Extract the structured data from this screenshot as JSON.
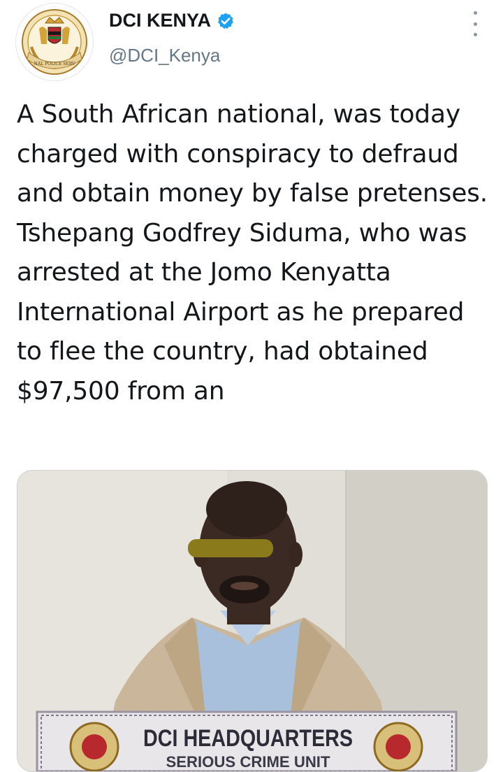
{
  "tweet": {
    "display_name": "DCI KENYA",
    "handle": "@DCI_Kenya",
    "text": "A South African national, was today charged with conspiracy to defraud and obtain money by false pretenses. Tshepang Godfrey Siduma, who was arrested at the Jomo Kenyatta International Airport as he prepared to flee the country, had obtained $97,500 from an"
  },
  "avatar": {
    "badge_text": "NAL POLICE SERV"
  },
  "media": {
    "placard_title": "DCI HEADQUARTERS",
    "placard_subtitle": "SERIOUS CRIME UNIT"
  },
  "colors": {
    "verified": "#1da1f2",
    "handle": "#657786",
    "text": "#14171a",
    "more": "#8899a6"
  },
  "icons": {
    "verified": "verified-badge-icon",
    "more": "more-vertical-icon"
  }
}
